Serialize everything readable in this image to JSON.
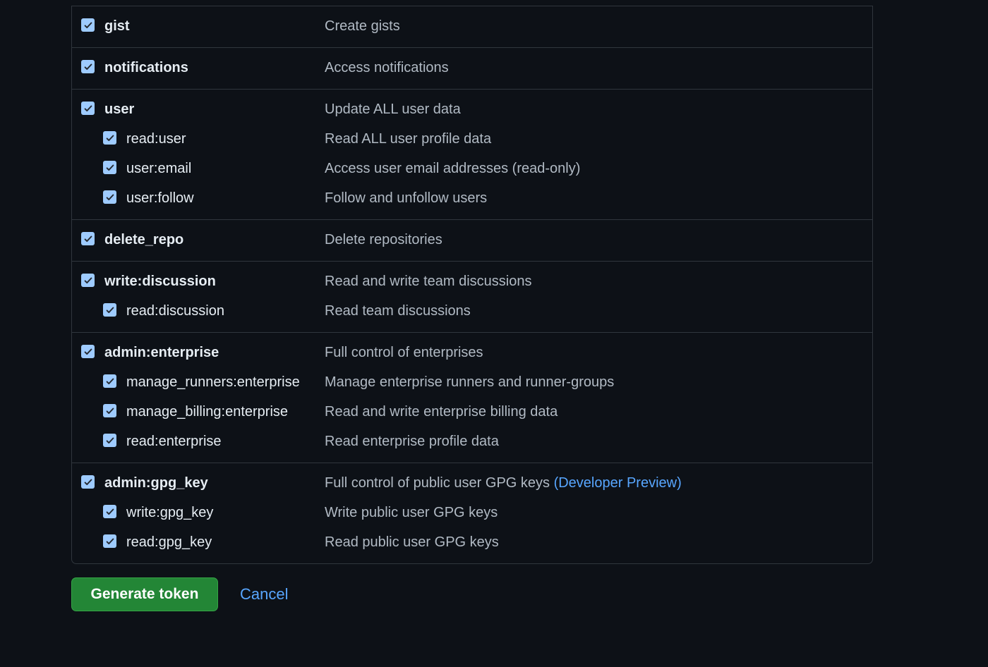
{
  "groups": [
    {
      "scope": {
        "name": "gist",
        "desc": "Create gists",
        "checked": true
      },
      "subs": []
    },
    {
      "scope": {
        "name": "notifications",
        "desc": "Access notifications",
        "checked": true
      },
      "subs": []
    },
    {
      "scope": {
        "name": "user",
        "desc": "Update ALL user data",
        "checked": true
      },
      "subs": [
        {
          "name": "read:user",
          "desc": "Read ALL user profile data",
          "checked": true
        },
        {
          "name": "user:email",
          "desc": "Access user email addresses (read-only)",
          "checked": true
        },
        {
          "name": "user:follow",
          "desc": "Follow and unfollow users",
          "checked": true
        }
      ]
    },
    {
      "scope": {
        "name": "delete_repo",
        "desc": "Delete repositories",
        "checked": true
      },
      "subs": []
    },
    {
      "scope": {
        "name": "write:discussion",
        "desc": "Read and write team discussions",
        "checked": true
      },
      "subs": [
        {
          "name": "read:discussion",
          "desc": "Read team discussions",
          "checked": true
        }
      ]
    },
    {
      "scope": {
        "name": "admin:enterprise",
        "desc": "Full control of enterprises",
        "checked": true
      },
      "subs": [
        {
          "name": "manage_runners:enterprise",
          "desc": "Manage enterprise runners and runner-groups",
          "checked": true
        },
        {
          "name": "manage_billing:enterprise",
          "desc": "Read and write enterprise billing data",
          "checked": true
        },
        {
          "name": "read:enterprise",
          "desc": "Read enterprise profile data",
          "checked": true
        }
      ]
    },
    {
      "scope": {
        "name": "admin:gpg_key",
        "desc": "Full control of public user GPG keys",
        "link": "(Developer Preview)",
        "checked": true
      },
      "subs": [
        {
          "name": "write:gpg_key",
          "desc": "Write public user GPG keys",
          "checked": true
        },
        {
          "name": "read:gpg_key",
          "desc": "Read public user GPG keys",
          "checked": true
        }
      ]
    }
  ],
  "actions": {
    "generate_label": "Generate token",
    "cancel_label": "Cancel"
  }
}
